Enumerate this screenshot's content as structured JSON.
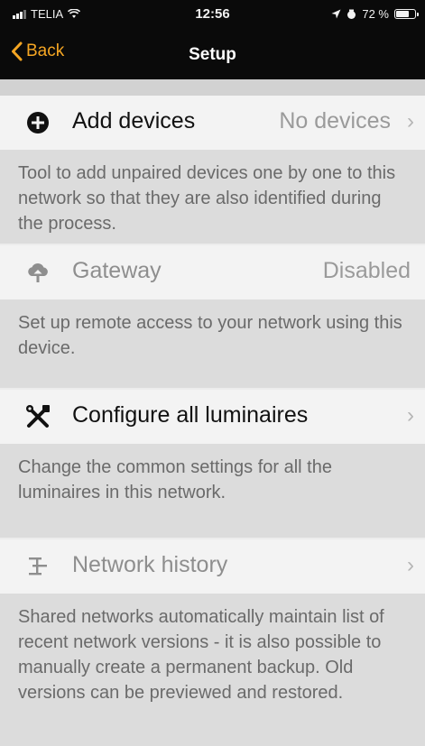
{
  "status_bar": {
    "carrier": "TELIA",
    "time": "12:56",
    "battery": "72 %",
    "battery_level": 0.72
  },
  "nav": {
    "back_label": "Back",
    "title": "Setup"
  },
  "colors": {
    "accent": "#f5a623",
    "nav_background": "#0a0a0a",
    "row_background": "#f3f3f3",
    "description_background": "#dcdcdc"
  },
  "items": [
    {
      "icon": "plus-circle-icon",
      "label": "Add devices",
      "value": "No devices",
      "description": "Tool to add unpaired devices one by one to this network so that they are also identified during the process."
    },
    {
      "icon": "cloud-upload-icon",
      "label": "Gateway",
      "value": "Disabled",
      "description": "Set up remote access to your network using this device."
    },
    {
      "icon": "wrench-tools-icon",
      "label": "Configure all luminaires",
      "value": "",
      "description": "Change the common settings for all the luminaires in this network."
    },
    {
      "icon": "history-tree-icon",
      "label": "Network history",
      "value": "",
      "description": "Shared networks automatically maintain list of recent network versions - it is also possible to manually create a permanent backup. Old versions can be previewed and restored."
    }
  ]
}
